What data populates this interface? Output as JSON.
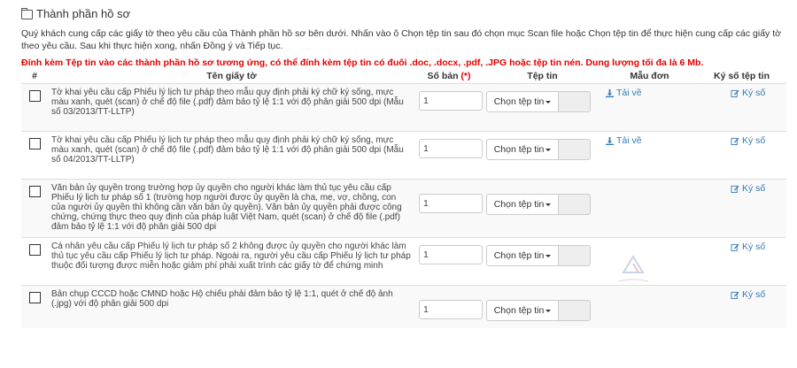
{
  "section": {
    "title": "Thành phần hồ sơ"
  },
  "intro": "Quý khách cung cấp các giấy tờ theo yêu cầu của Thành phần hồ sơ bên dưới. Nhấn vào ô Chọn tệp tin sau đó chọn mục Scan file hoặc Chọn tệp tin để thực hiện cung cấp các giấy tờ theo yêu cầu. Sau khi thực hiện xong, nhấn Đồng ý và Tiếp tục.",
  "warning": "Đính kèm Tệp tin vào các thành phần hồ sơ tương ứng, có thể đính kèm tệp tin có đuôi .doc, .docx, .pdf, .JPG hoặc tệp tin nén. Dung lượng tối đa là 6 Mb.",
  "table": {
    "headers": {
      "num": "#",
      "name": "Tên giấy tờ",
      "qty": "Số bản",
      "qty_req": "(*)",
      "file": "Tệp tin",
      "form": "Mẫu đơn",
      "sign": "Ký số tệp tin"
    },
    "rows": [
      {
        "name": "Tờ khai yêu cầu cấp Phiếu lý lịch tư pháp theo mẫu quy định phải ký chữ ký sống, mực màu xanh, quét (scan) ở chế độ file (.pdf) đảm bảo tỷ lệ 1:1 với độ phân giải 500 dpi (Mẫu số 03/2013/TT-LLTP)",
        "qty": "1",
        "file_label": "Chọn tệp tin",
        "form_link": "Tải về",
        "sign_link": "Ký số"
      },
      {
        "name": "Tờ khai yêu cầu cấp Phiếu lý lịch tư pháp theo mẫu quy định phải ký chữ ký sống, mực màu xanh, quét (scan) ở chế độ file (.pdf) đảm bảo tỷ lệ 1:1 với độ phân giải 500 dpi (Mẫu số 04/2013/TT-LLTP)",
        "qty": "1",
        "file_label": "Chọn tệp tin",
        "form_link": "Tải về",
        "sign_link": "Ký số"
      },
      {
        "name": "Văn bản ủy quyền trong trường hợp ủy quyền cho người khác làm thủ tục yêu cầu cấp Phiếu lý lịch tư pháp số 1 (trường hợp người được ủy quyền là cha, mẹ, vợ, chồng, con của người ủy quyền thì không cần văn bản ủy quyền). Văn bản ủy quyền phải được công chứng, chứng thực theo quy định của pháp luật Việt Nam, quét (scan) ở chế độ file (.pdf) đảm bảo tỷ lệ 1:1 với độ phân giải 500 dpi",
        "qty": "1",
        "file_label": "Chọn tệp tin",
        "form_link": "",
        "sign_link": "Ký số"
      },
      {
        "name": "Cá nhân yêu cầu cấp Phiếu lý lịch tư pháp số 2 không được ủy quyền cho người khác làm thủ tục yêu cầu cấp Phiếu lý lịch tư pháp. Ngoài ra, người yêu cầu cấp Phiếu lý lịch tư pháp thuộc đối tượng được miễn hoặc giảm phí phải xuất trình các giấy tờ để chứng minh",
        "qty": "1",
        "file_label": "Chọn tệp tin",
        "form_link": "",
        "sign_link": "Ký số"
      },
      {
        "name": "Bản chụp CCCD hoặc CMND hoặc Hộ chiếu phải đảm bảo tỷ lệ 1:1, quét ở chế độ ảnh (.jpg) với độ phân giải 500 dpi",
        "qty": "1",
        "file_label": "Chọn tệp tin",
        "form_link": "",
        "sign_link": "Ký số"
      }
    ]
  },
  "colors": {
    "warning": "#e00000",
    "link": "#337ab7"
  },
  "icons": {
    "section": "folder-icon",
    "download": "download-icon",
    "sign": "edit-sign-icon"
  }
}
